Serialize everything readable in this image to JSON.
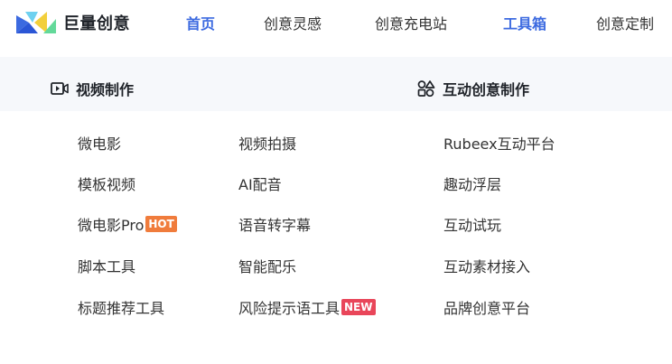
{
  "header": {
    "logo_text": "巨量创意",
    "nav": [
      {
        "label": "首页",
        "active": true
      },
      {
        "label": "创意灵感",
        "active": false
      },
      {
        "label": "创意充电站",
        "active": false
      },
      {
        "label": "工具箱",
        "active": true
      },
      {
        "label": "创意定制",
        "active": false
      }
    ]
  },
  "menu": {
    "video": {
      "title": "视频制作",
      "icon": "video-camera-icon",
      "col1": [
        "微电影",
        "模板视频",
        "微电影Pro",
        "脚本工具",
        "标题推荐工具"
      ],
      "col2": [
        "视频拍摄",
        "AI配音",
        "语音转字幕",
        "智能配乐",
        "风险提示语工具"
      ]
    },
    "interactive": {
      "title": "互动创意制作",
      "icon": "shapes-icon",
      "items": [
        "Rubeex互动平台",
        "趣动浮层",
        "互动试玩",
        "互动素材接入",
        "品牌创意平台"
      ]
    },
    "badges": {
      "hot": {
        "label": "HOT",
        "color": "#f07c3c"
      },
      "new": {
        "label": "NEW",
        "color": "#e9465a"
      }
    }
  },
  "colors": {
    "accent": "#3c6ae0",
    "panel_bg": "#f6f8fb"
  }
}
